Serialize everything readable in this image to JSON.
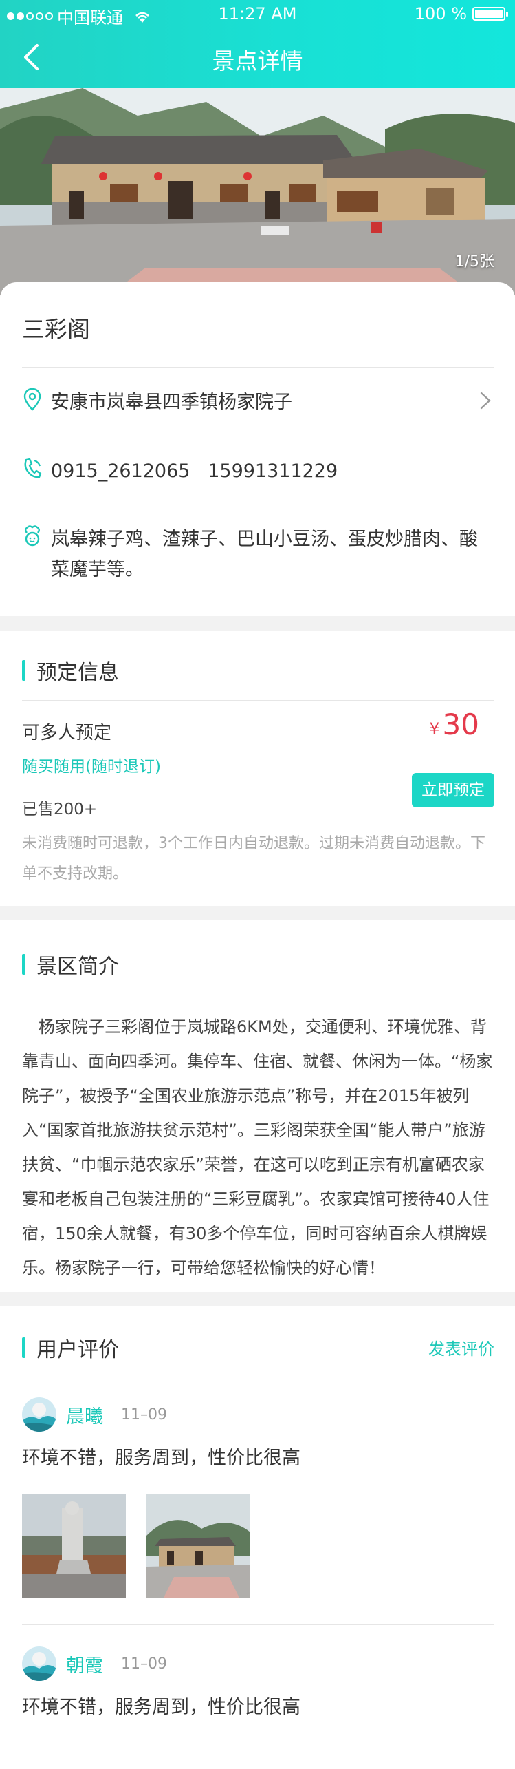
{
  "status_bar": {
    "carrier": "中国联通",
    "time": "11:27 AM",
    "battery": "100 %"
  },
  "nav": {
    "title": "景点详情"
  },
  "hero": {
    "counter": "1/5张"
  },
  "place": {
    "name": "三彩阁",
    "address": "安康市岚皋县四季镇杨家院子",
    "phone": "0915_2612065   15991311229",
    "dishes": "岚皋辣子鸡、渣辣子、巴山小豆汤、蛋皮炒腊肉、酸菜魔芋等。"
  },
  "booking": {
    "title": "预定信息",
    "type": "可多人预定",
    "policy": "随买随用(随时退订)",
    "sold": "已售200+",
    "currency": "¥",
    "price": "30",
    "button": "立即预定",
    "note": "未消费随时可退款，3个工作日内自动退款。过期未消费自动退款。下单不支持改期。"
  },
  "intro": {
    "title": "景区简介",
    "body": "杨家院子三彩阁位于岚城路6KM处，交通便利、环境优雅、背靠青山、面向四季河。集停车、住宿、就餐、休闲为一体。“杨家院子”，被授予“全国农业旅游示范点”称号，并在2015年被列入“国家首批旅游扶贫示范村”。三彩阁荣获全国“能人带户”旅游扶贫、“巾帼示范农家乐”荣誉，在这可以吃到正宗有机富硒农家宴和老板自己包装注册的“三彩豆腐乳”。农家宾馆可接待40人住宿，150余人就餐，有30多个停车位，同时可容纳百余人棋牌娱乐。杨家院子一行，可带给您轻松愉快的好心情！"
  },
  "reviews": {
    "title": "用户评价",
    "post_label": "发表评价",
    "items": [
      {
        "user": "晨曦",
        "date": "11–09",
        "text": "环境不错，服务周到，性价比很高"
      },
      {
        "user": "朝霞",
        "date": "11–09",
        "text": "环境不错，服务周到，性价比很高"
      }
    ]
  },
  "colors": {
    "accent": "#1cd6c6",
    "price": "#e43a4b"
  }
}
